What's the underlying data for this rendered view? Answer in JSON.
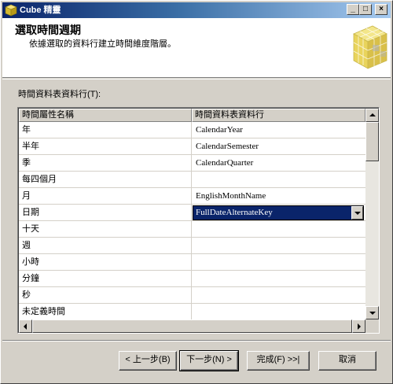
{
  "window": {
    "title": "Cube 精靈"
  },
  "titlebar_buttons": {
    "minimize": "_",
    "maximize": "□",
    "close": "×"
  },
  "header": {
    "title": "選取時間週期",
    "description": "依據選取的資料行建立時間維度階層。"
  },
  "section_label": "時間資料表資料行(T):",
  "grid": {
    "columns": [
      "時間屬性名稱",
      "時間資料表資料行"
    ],
    "rows": [
      {
        "name": "年",
        "column": "CalendarYear"
      },
      {
        "name": "半年",
        "column": "CalendarSemester"
      },
      {
        "name": "季",
        "column": "CalendarQuarter"
      },
      {
        "name": "每四個月",
        "column": ""
      },
      {
        "name": "月",
        "column": "EnglishMonthName"
      },
      {
        "name": "日期",
        "column": "FullDateAlternateKey"
      },
      {
        "name": "十天",
        "column": ""
      },
      {
        "name": "週",
        "column": ""
      },
      {
        "name": "小時",
        "column": ""
      },
      {
        "name": "分鐘",
        "column": ""
      },
      {
        "name": "秒",
        "column": ""
      },
      {
        "name": "未定義時間",
        "column": ""
      }
    ],
    "selected_row": 5
  },
  "buttons": {
    "back": "< 上一步(B)",
    "next": "下一步(N) >",
    "finish": "完成(F) >>|",
    "cancel": "取消"
  },
  "colors": {
    "title_gradient_start": "#0a246a",
    "title_gradient_end": "#a6caf0",
    "selection": "#0a246a",
    "face": "#d4d0c8"
  }
}
